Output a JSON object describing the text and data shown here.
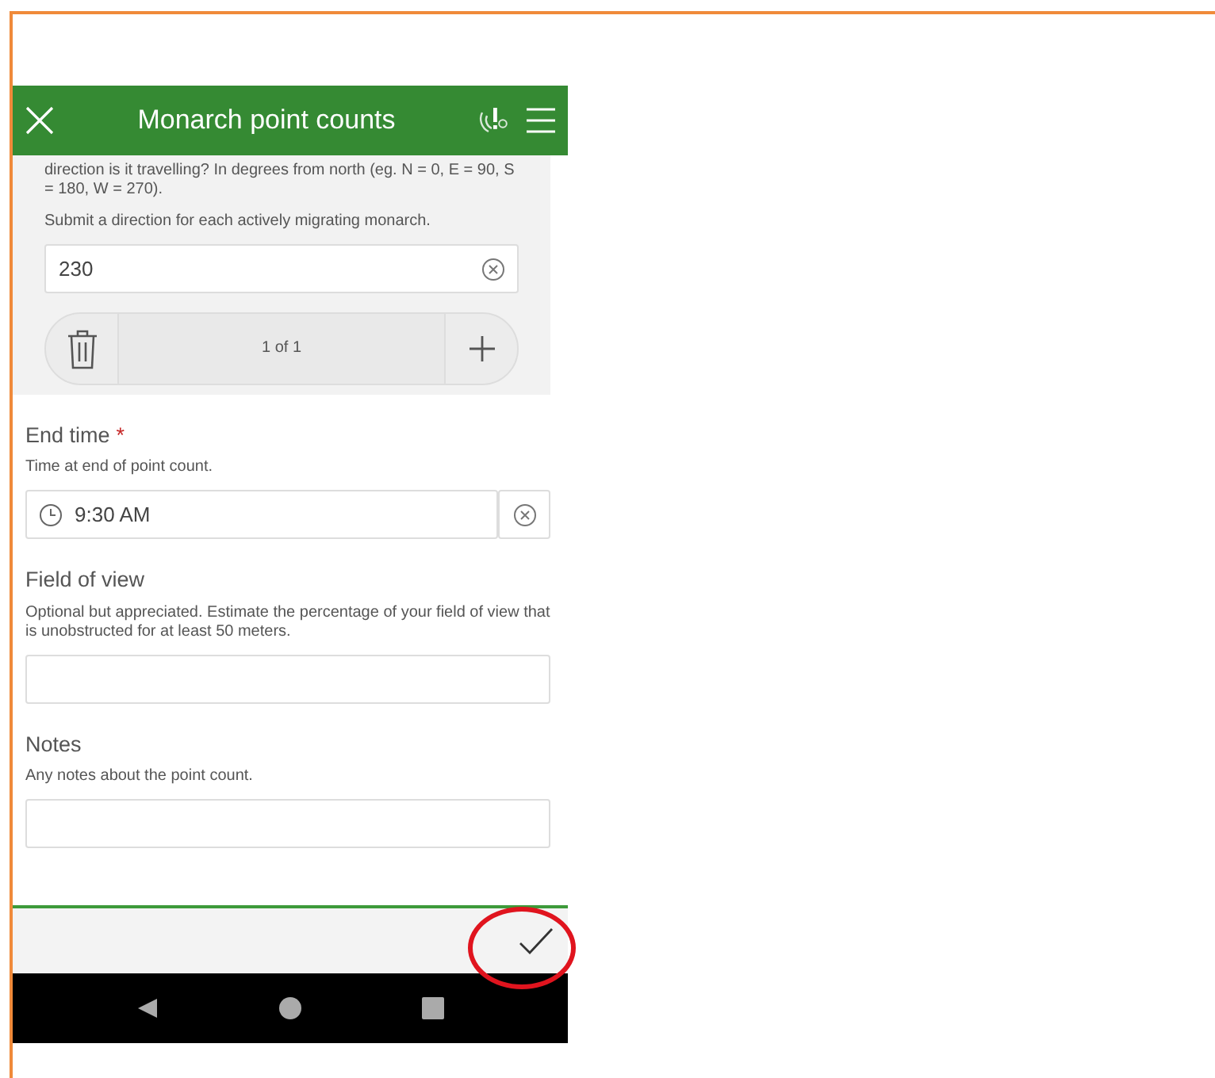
{
  "header": {
    "title": "Monarch point counts"
  },
  "repeat_section": {
    "description": "direction is it travelling? In degrees from north (eg. N = 0, E = 90, S = 180, W = 270).",
    "hint": "Submit a direction for each actively migrating monarch.",
    "value": "230",
    "pager": "1 of 1"
  },
  "questions": [
    {
      "kind": "time",
      "label": "End time",
      "required_mark": "*",
      "hint": "Time at end of point count.",
      "value": "9:30 AM"
    },
    {
      "kind": "text",
      "label": "Field of view",
      "hint": "Optional but appreciated. Estimate the percentage of your field of view that is unobstructed for at least 50 meters."
    },
    {
      "kind": "text",
      "label": "Notes",
      "hint": "Any notes about the point count."
    }
  ]
}
